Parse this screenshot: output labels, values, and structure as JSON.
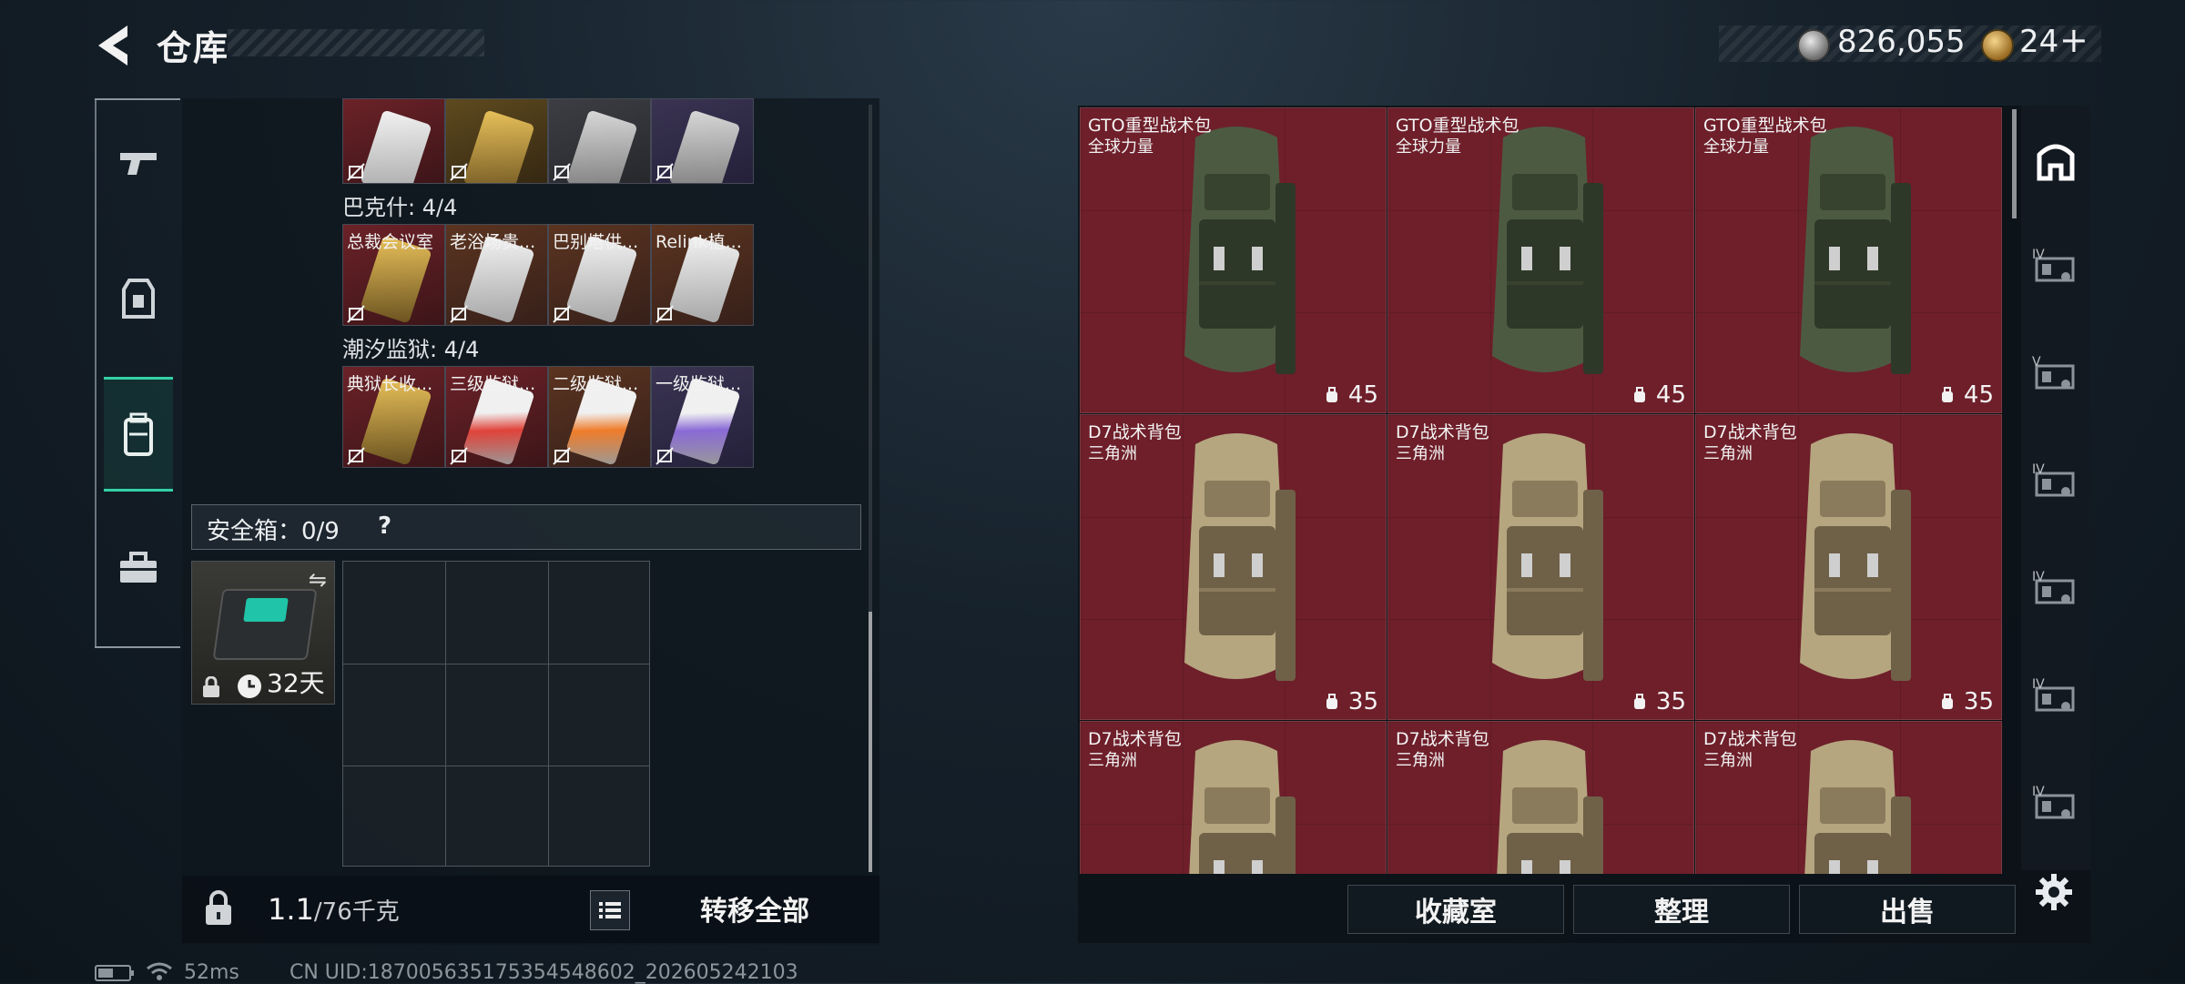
{
  "header": {
    "title": "仓库",
    "currency_silver": "826,055",
    "currency_gold": "24",
    "plus_label": "+"
  },
  "keycards": {
    "row1": [
      {
        "label": "",
        "bg": "red",
        "card": "white"
      },
      {
        "label": "",
        "bg": "gold",
        "card": "gold"
      },
      {
        "label": "",
        "bg": "grey",
        "card": "silver"
      },
      {
        "label": "",
        "bg": "purple",
        "card": "silver"
      }
    ],
    "group2_label": "巴克什: 4/4",
    "row2": [
      {
        "label": "总裁会议室",
        "bg": "red",
        "card": "gold"
      },
      {
        "label": "老浴场贵...",
        "bg": "brown",
        "card": "white"
      },
      {
        "label": "巴别塔供...",
        "bg": "brown",
        "card": "white"
      },
      {
        "label": "Relink植...",
        "bg": "brown",
        "card": "white"
      }
    ],
    "group3_label": "潮汐监狱: 4/4",
    "row3": [
      {
        "label": "典狱长收...",
        "bg": "red",
        "card": "gold"
      },
      {
        "label": "三级监狱...",
        "bg": "red",
        "card": "red"
      },
      {
        "label": "二级监狱...",
        "bg": "brown",
        "card": "orange"
      },
      {
        "label": "一级监狱...",
        "bg": "purple",
        "card": "violet"
      }
    ]
  },
  "safe": {
    "title": "安全箱：0/9",
    "help": "?",
    "case_days": "32天"
  },
  "bottom_left": {
    "weight_value": "1.1",
    "weight_total": "/76千克",
    "transfer_label": "转移全部"
  },
  "status": {
    "ping": "52ms",
    "uid": "CN UID:18700563517535454860​2_202605242103"
  },
  "items": [
    {
      "name": "GTO重型战术包",
      "sub": "全球力量",
      "capacity": "45",
      "tone": "green"
    },
    {
      "name": "GTO重型战术包",
      "sub": "全球力量",
      "capacity": "45",
      "tone": "green"
    },
    {
      "name": "GTO重型战术包",
      "sub": "全球力量",
      "capacity": "45",
      "tone": "green"
    },
    {
      "name": "D7战术背包",
      "sub": "三角洲",
      "capacity": "35",
      "tone": "tan"
    },
    {
      "name": "D7战术背包",
      "sub": "三角洲",
      "capacity": "35",
      "tone": "tan"
    },
    {
      "name": "D7战术背包",
      "sub": "三角洲",
      "capacity": "35",
      "tone": "tan"
    },
    {
      "name": "D7战术背包",
      "sub": "三角洲",
      "capacity": "",
      "tone": "tan"
    },
    {
      "name": "D7战术背包",
      "sub": "三角洲",
      "capacity": "",
      "tone": "tan"
    },
    {
      "name": "D7战术背包",
      "sub": "三角洲",
      "capacity": "",
      "tone": "tan"
    }
  ],
  "right_tabs": [
    {
      "icon": "backpack-slot-icon",
      "level": ""
    },
    {
      "icon": "chest-rig-icon",
      "level": "IV"
    },
    {
      "icon": "chest-rig-icon",
      "level": "V"
    },
    {
      "icon": "chest-rig-icon",
      "level": "IV"
    },
    {
      "icon": "chest-rig-icon",
      "level": "IV"
    },
    {
      "icon": "chest-rig-icon",
      "level": "IV"
    },
    {
      "icon": "chest-rig-icon",
      "level": "IV"
    }
  ],
  "actions": {
    "collection": "收藏室",
    "organize": "整理",
    "sell": "出售"
  },
  "colors": {
    "accent": "#33d1a6",
    "item_bg": "#6e1f2a"
  }
}
